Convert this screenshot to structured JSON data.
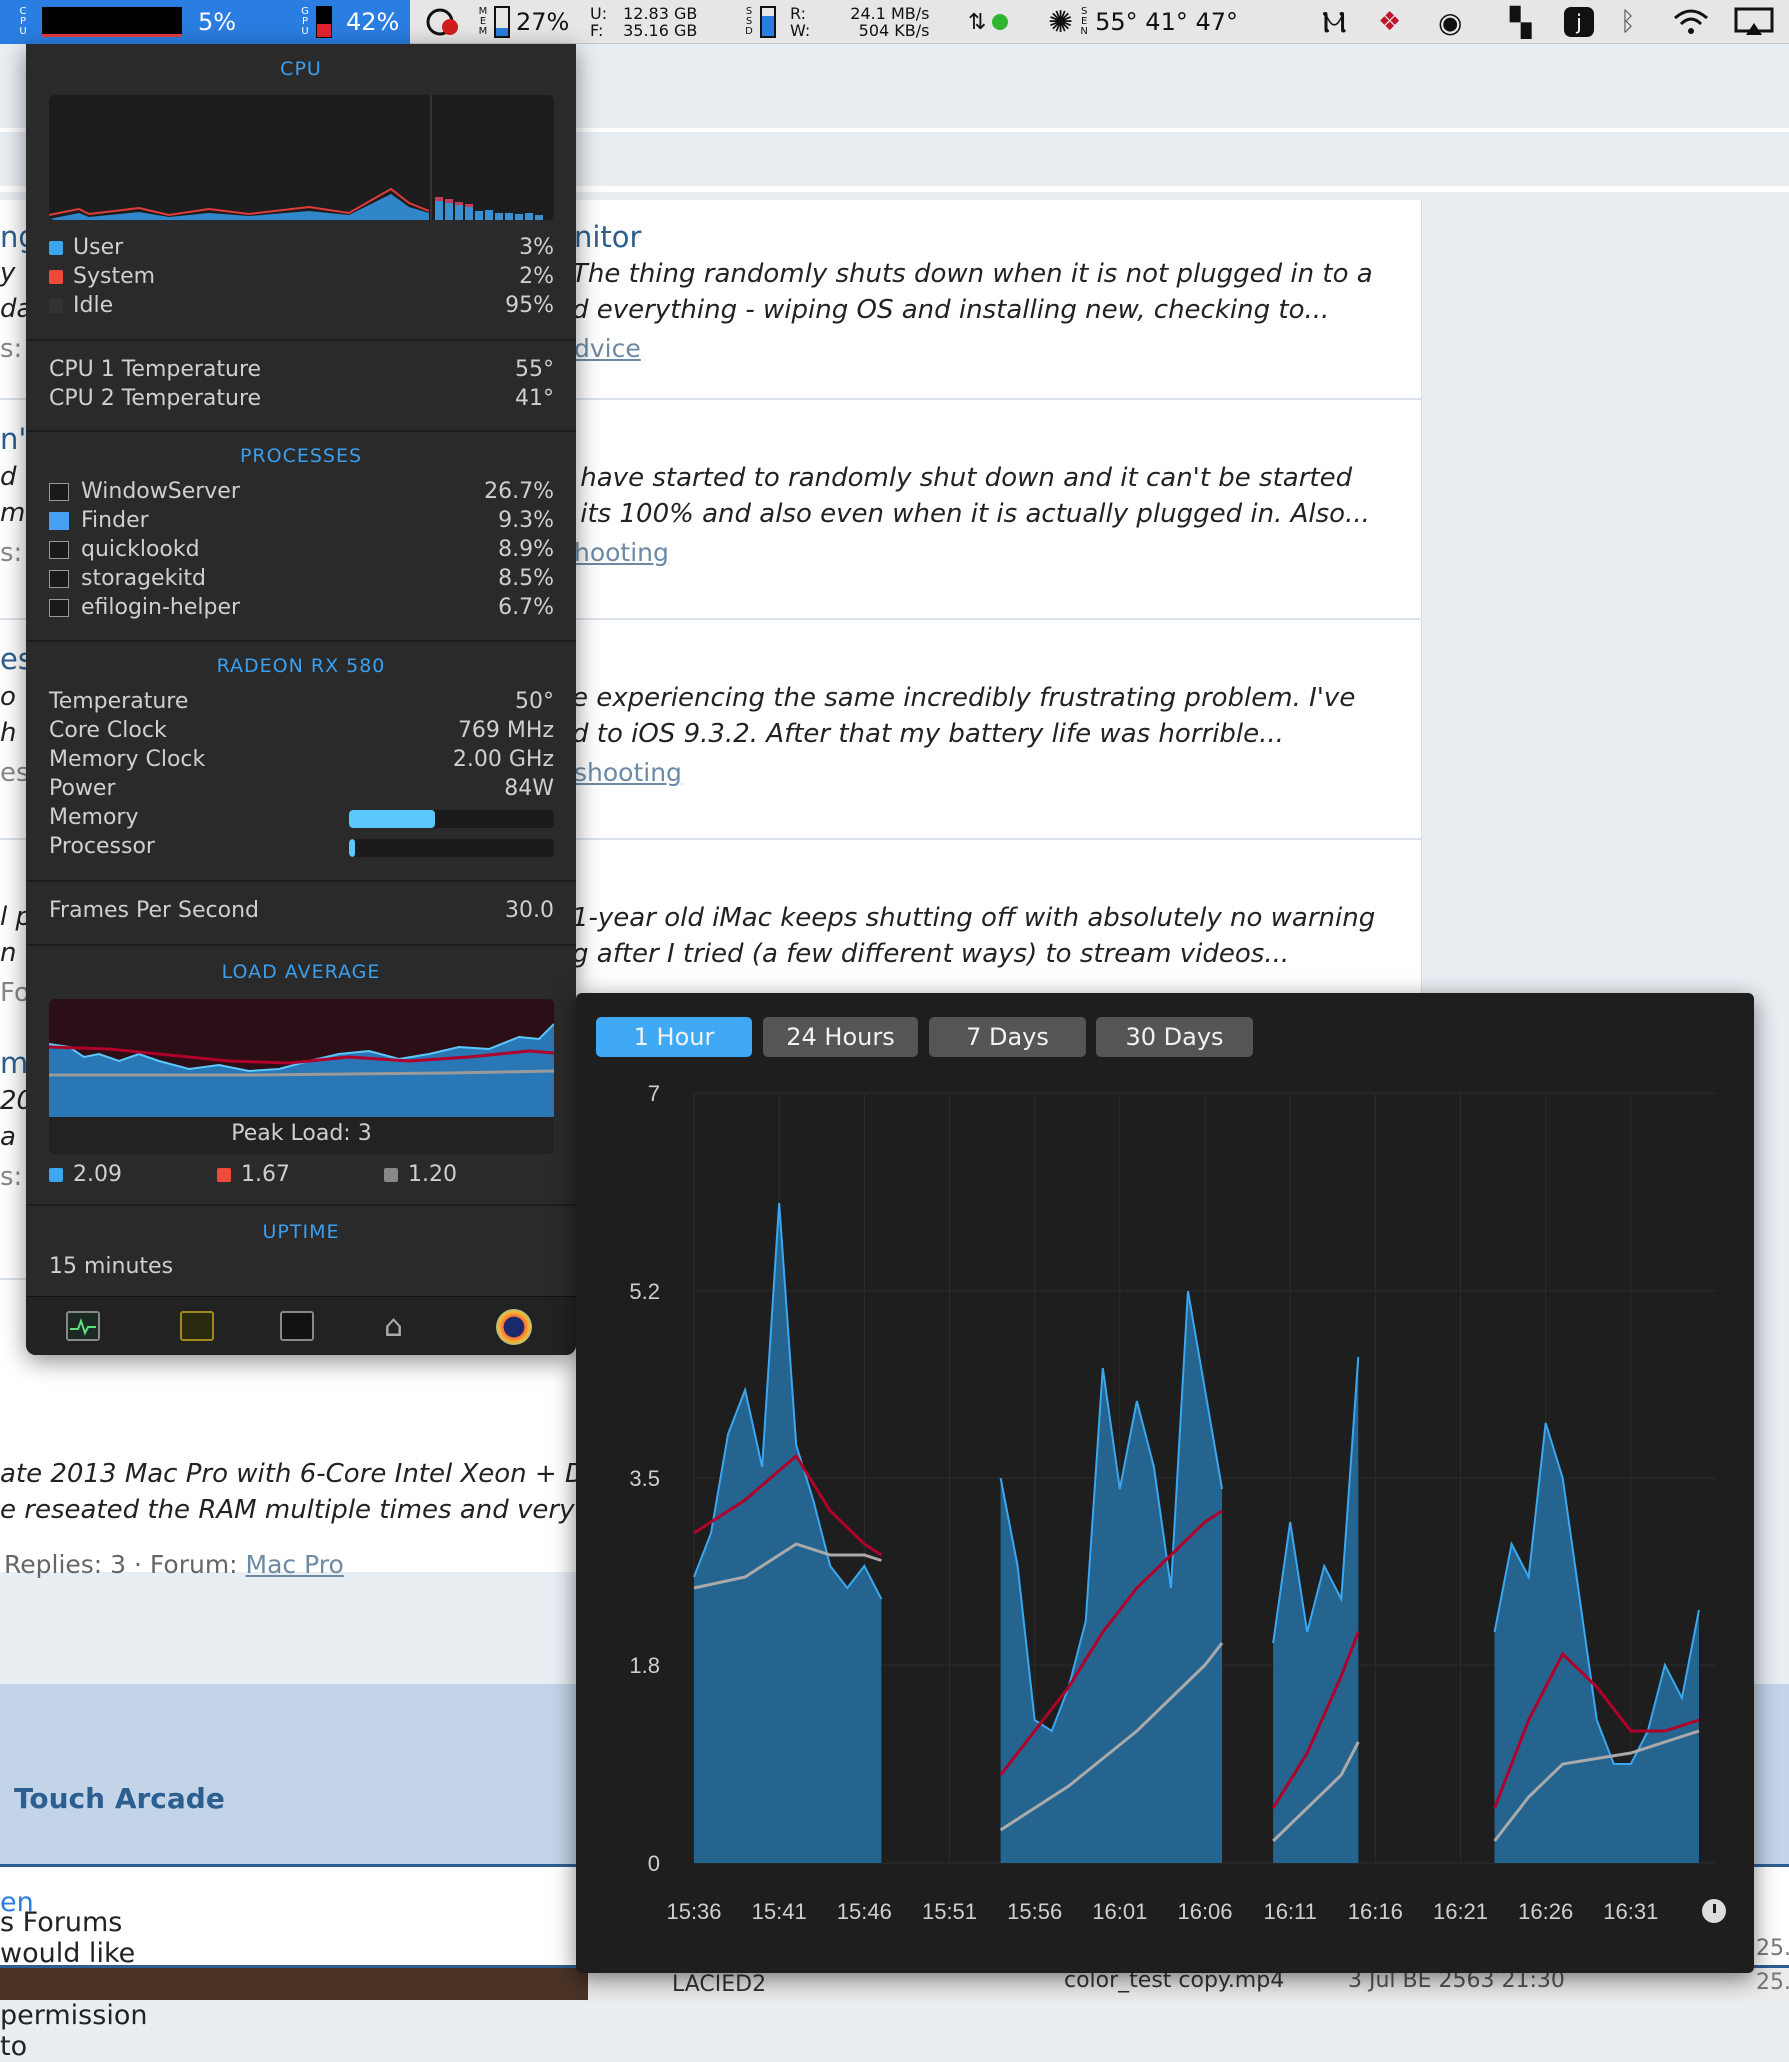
{
  "menubar": {
    "cpu_label": "C\nP\nU",
    "cpu_percent": "5%",
    "gpu_label": "G\nP\nU",
    "gpu_percent": "42%",
    "mem_label": "M\nE\nM",
    "mem_percent": "27%",
    "disk_u_label": "U:",
    "disk_f_label": "F:",
    "disk_used": "12.83 GB",
    "disk_free": "35.16 GB",
    "ssd_label": "S\nS\nD",
    "net_r_label": "R:",
    "net_w_label": "W:",
    "net_read": "24.1 MB/s",
    "net_write": "504 KB/s",
    "sensor_label": "S\nE\nN",
    "temps": "55° 41° 47°"
  },
  "page": {
    "results": [
      {
        "title": "nitor",
        "snippet": "The thing randomly shuts down when it is not plugged in to a\nd everything - wiping OS and installing new, checking to...",
        "forum_link": "dvice",
        "left_fragments": [
          "ng",
          "y",
          "da",
          "s:"
        ]
      },
      {
        "snippet": " have started to randomly shut down and it can't be started\n its 100% and also even when it is actually plugged in. Also...",
        "forum_link": "hooting",
        "left_fragments": [
          "n't",
          "d f",
          "m",
          "s:"
        ]
      },
      {
        "snippet": "e experiencing the same incredibly frustrating problem. I've\nd to iOS 9.3.2. After that my battery life was horrible...",
        "forum_link": "shooting",
        "left_fragments": [
          "es",
          "o",
          "h",
          "es"
        ]
      },
      {
        "snippet": "1-year old iMac keeps shutting off with absolutely no warning\ng after I tried (a few different ways) to stream videos...",
        "left_fragments": [
          "l p",
          "n",
          "Fo",
          "ml",
          "20",
          "a",
          "s:"
        ]
      }
    ],
    "last_snippet": "ate 2013 Mac Pro with 6-Core Intel Xeon + D\ne reseated the RAM multiple times and very",
    "last_meta_prefix": "Replies: 3 · Forum: ",
    "last_meta_link": "Mac Pro",
    "footer_title": "Touch Arcade",
    "cookie_text": "s Forums would like your permission to ",
    "cookie_link": "en",
    "finder_row_name": "LACIED2",
    "finder_row_file": "color_test copy.mp4",
    "finder_row_date": "3 Jul BE 2563 21:30",
    "finder_right_a": "25.",
    "finder_right_b": "25."
  },
  "panel": {
    "cpu_title": "CPU",
    "user_label": "User",
    "user_value": "3%",
    "system_label": "System",
    "system_value": "2%",
    "idle_label": "Idle",
    "idle_value": "95%",
    "cpu1_temp_label": "CPU 1 Temperature",
    "cpu1_temp": "55°",
    "cpu2_temp_label": "CPU 2 Temperature",
    "cpu2_temp": "41°",
    "processes_title": "PROCESSES",
    "processes": [
      {
        "name": "WindowServer",
        "value": "26.7%"
      },
      {
        "name": "Finder",
        "value": "9.3%"
      },
      {
        "name": "quicklookd",
        "value": "8.9%"
      },
      {
        "name": "storagekitd",
        "value": "8.5%"
      },
      {
        "name": "efilogin-helper",
        "value": "6.7%"
      }
    ],
    "gpu_title": "RADEON RX 580",
    "gpu_rows": [
      {
        "label": "Temperature",
        "value": "50°"
      },
      {
        "label": "Core Clock",
        "value": "769 MHz"
      },
      {
        "label": "Memory Clock",
        "value": "2.00 GHz"
      },
      {
        "label": "Power",
        "value": "84W"
      }
    ],
    "gpu_memory_label": "Memory",
    "gpu_memory_fill": 0.42,
    "gpu_processor_label": "Processor",
    "gpu_processor_fill": 0.03,
    "fps_label": "Frames Per Second",
    "fps_value": "30.0",
    "load_title": "LOAD AVERAGE",
    "peak_load": "Peak Load: 3",
    "load_1": "2.09",
    "load_5": "1.67",
    "load_15": "1.20",
    "uptime_title": "UPTIME",
    "uptime_value": "15 minutes",
    "colors": {
      "user": "#3aa7f0",
      "system": "#f04a3a",
      "idle": "#333333",
      "accent": "#3b9ff0"
    }
  },
  "history": {
    "tabs": [
      "1 Hour",
      "24 Hours",
      "7 Days",
      "30 Days"
    ],
    "active_tab": 0,
    "y_ticks": [
      "7",
      "5.2",
      "3.5",
      "1.8",
      "0"
    ],
    "x_ticks": [
      "15:36",
      "15:41",
      "15:46",
      "15:51",
      "15:56",
      "16:01",
      "16:06",
      "16:11",
      "16:16",
      "16:21",
      "16:26",
      "16:31"
    ]
  },
  "chart_data": {
    "type": "area",
    "ylim": [
      0,
      7
    ],
    "x_unit": "time (HH:MM)",
    "series": [
      {
        "color": "#3aa7f0",
        "segments": [
          {
            "x": [
              "15:36",
              "15:37",
              "15:38",
              "15:39",
              "15:40",
              "15:41",
              "15:42",
              "15:43",
              "15:44",
              "15:45",
              "15:46",
              "15:47"
            ],
            "values": [
              2.6,
              3.0,
              3.9,
              4.3,
              3.6,
              6.0,
              3.8,
              3.3,
              2.7,
              2.5,
              2.7,
              2.4
            ]
          },
          {
            "x": [
              "15:54",
              "15:55",
              "15:56",
              "15:57",
              "15:58",
              "15:59",
              "16:00",
              "16:01",
              "16:02",
              "16:03",
              "16:04",
              "16:05",
              "16:06",
              "16:07"
            ],
            "values": [
              3.5,
              2.7,
              1.3,
              1.2,
              1.6,
              2.2,
              4.5,
              3.4,
              4.2,
              3.6,
              2.5,
              5.2,
              4.3,
              3.4
            ]
          },
          {
            "x": [
              "16:10",
              "16:11",
              "16:12",
              "16:13",
              "16:14",
              "16:15"
            ],
            "values": [
              2.0,
              3.1,
              2.1,
              2.7,
              2.4,
              4.6
            ]
          },
          {
            "x": [
              "16:23",
              "16:24",
              "16:25",
              "16:26",
              "16:27",
              "16:28",
              "16:29",
              "16:30",
              "16:31",
              "16:32",
              "16:33",
              "16:34",
              "16:35"
            ],
            "values": [
              2.1,
              2.9,
              2.6,
              4.0,
              3.5,
              2.4,
              1.3,
              0.9,
              0.9,
              1.2,
              1.8,
              1.5,
              2.3
            ]
          }
        ]
      },
      {
        "color": "#b0002a",
        "segments": [
          {
            "x": [
              "15:36",
              "15:39",
              "15:42",
              "15:44",
              "15:46",
              "15:47"
            ],
            "values": [
              3.0,
              3.3,
              3.7,
              3.2,
              2.9,
              2.8
            ]
          },
          {
            "x": [
              "15:54",
              "15:56",
              "15:58",
              "16:00",
              "16:02",
              "16:04",
              "16:06",
              "16:07"
            ],
            "values": [
              0.8,
              1.2,
              1.6,
              2.1,
              2.5,
              2.8,
              3.1,
              3.2
            ]
          },
          {
            "x": [
              "16:10",
              "16:12",
              "16:14",
              "16:15"
            ],
            "values": [
              0.5,
              1.0,
              1.7,
              2.1
            ]
          },
          {
            "x": [
              "16:23",
              "16:25",
              "16:27",
              "16:29",
              "16:31",
              "16:33",
              "16:35"
            ],
            "values": [
              0.5,
              1.3,
              1.9,
              1.6,
              1.2,
              1.2,
              1.3
            ]
          }
        ]
      },
      {
        "color": "#aaaaaa",
        "segments": [
          {
            "x": [
              "15:36",
              "15:39",
              "15:42",
              "15:44",
              "15:46",
              "15:47"
            ],
            "values": [
              2.5,
              2.6,
              2.9,
              2.8,
              2.8,
              2.75
            ]
          },
          {
            "x": [
              "15:54",
              "15:56",
              "15:58",
              "16:00",
              "16:02",
              "16:04",
              "16:06",
              "16:07"
            ],
            "values": [
              0.3,
              0.5,
              0.7,
              0.95,
              1.2,
              1.5,
              1.8,
              2.0
            ]
          },
          {
            "x": [
              "16:10",
              "16:12",
              "16:14",
              "16:15"
            ],
            "values": [
              0.2,
              0.5,
              0.8,
              1.1
            ]
          },
          {
            "x": [
              "16:23",
              "16:25",
              "16:27",
              "16:29",
              "16:31",
              "16:33",
              "16:35"
            ],
            "values": [
              0.2,
              0.6,
              0.9,
              0.95,
              1.0,
              1.1,
              1.2
            ]
          }
        ]
      }
    ],
    "grid": true
  }
}
